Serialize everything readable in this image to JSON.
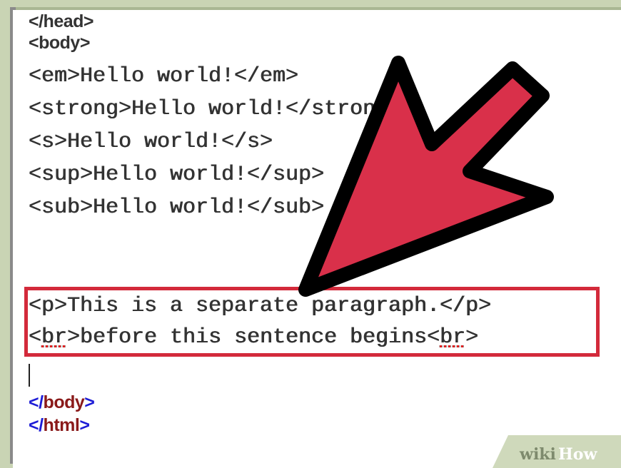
{
  "editor": {
    "lines": {
      "head_close": "</head>",
      "body_open": "<body>",
      "em_line": "<em>Hello world!</em>",
      "strong_line": "<strong>Hello world!</strong>",
      "s_line": "<s>Hello world!</s>",
      "sup_line": "<sup>Hello world!</sup>",
      "sub_line": "<sub>Hello world!</sub>",
      "p_line": "<p>This is a separate paragraph.</p>",
      "br_line": {
        "open_a": "<",
        "br1": "br",
        "mid": ">before this sentence begins<",
        "br2": "br",
        "close": ">"
      },
      "body_close": {
        "lt_slash": "</",
        "name": "body",
        "gt": ">"
      },
      "html_close": {
        "lt_slash": "</",
        "name": "html",
        "gt": ">"
      }
    }
  },
  "annotation": {
    "box_color": "#d32a3b",
    "arrow_color": "#d9304a"
  },
  "watermark": {
    "wiki": "wiki",
    "how": "How"
  },
  "icons": [
    "pointer-arrow-icon"
  ]
}
